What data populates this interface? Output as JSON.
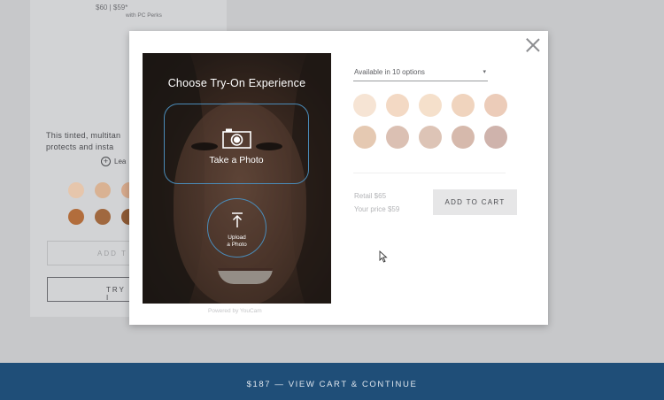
{
  "background": {
    "price_text": "$60 | $59*",
    "price_subtext": "with PC Perks",
    "description": "This tinted, multitan protects and insta",
    "learn_link": "Lea",
    "add_button_partial": "ADD T",
    "try_button_partial": "TRY I",
    "swatch_colors": [
      "#e6c6ac",
      "#d9b293",
      "#d5a98c",
      "#b26d3c",
      "#a0683f",
      "#8e5a35"
    ]
  },
  "modal": {
    "title": "Choose Try-On Experience",
    "take_photo_label": "Take a Photo",
    "upload_photo_label_line1": "Upload",
    "upload_photo_label_line2": "a Photo",
    "powered_by": "Powered by YouCam",
    "shade_dropdown": "Available in 10 options",
    "shade_colors": [
      "#f6e4d4",
      "#f3d9c4",
      "#f5e0cb",
      "#f0d4be",
      "#ecccb9",
      "#e5c9b2",
      "#dbc0b3",
      "#ddc4b6",
      "#d6b9ac",
      "#cfb3ac"
    ],
    "retail_label": "Retail $65",
    "your_price_label": "Your price $59",
    "add_to_cart_label": "ADD TO CART"
  },
  "footer": {
    "cart_bar_label": "$187 — VIEW CART & CONTINUE"
  }
}
